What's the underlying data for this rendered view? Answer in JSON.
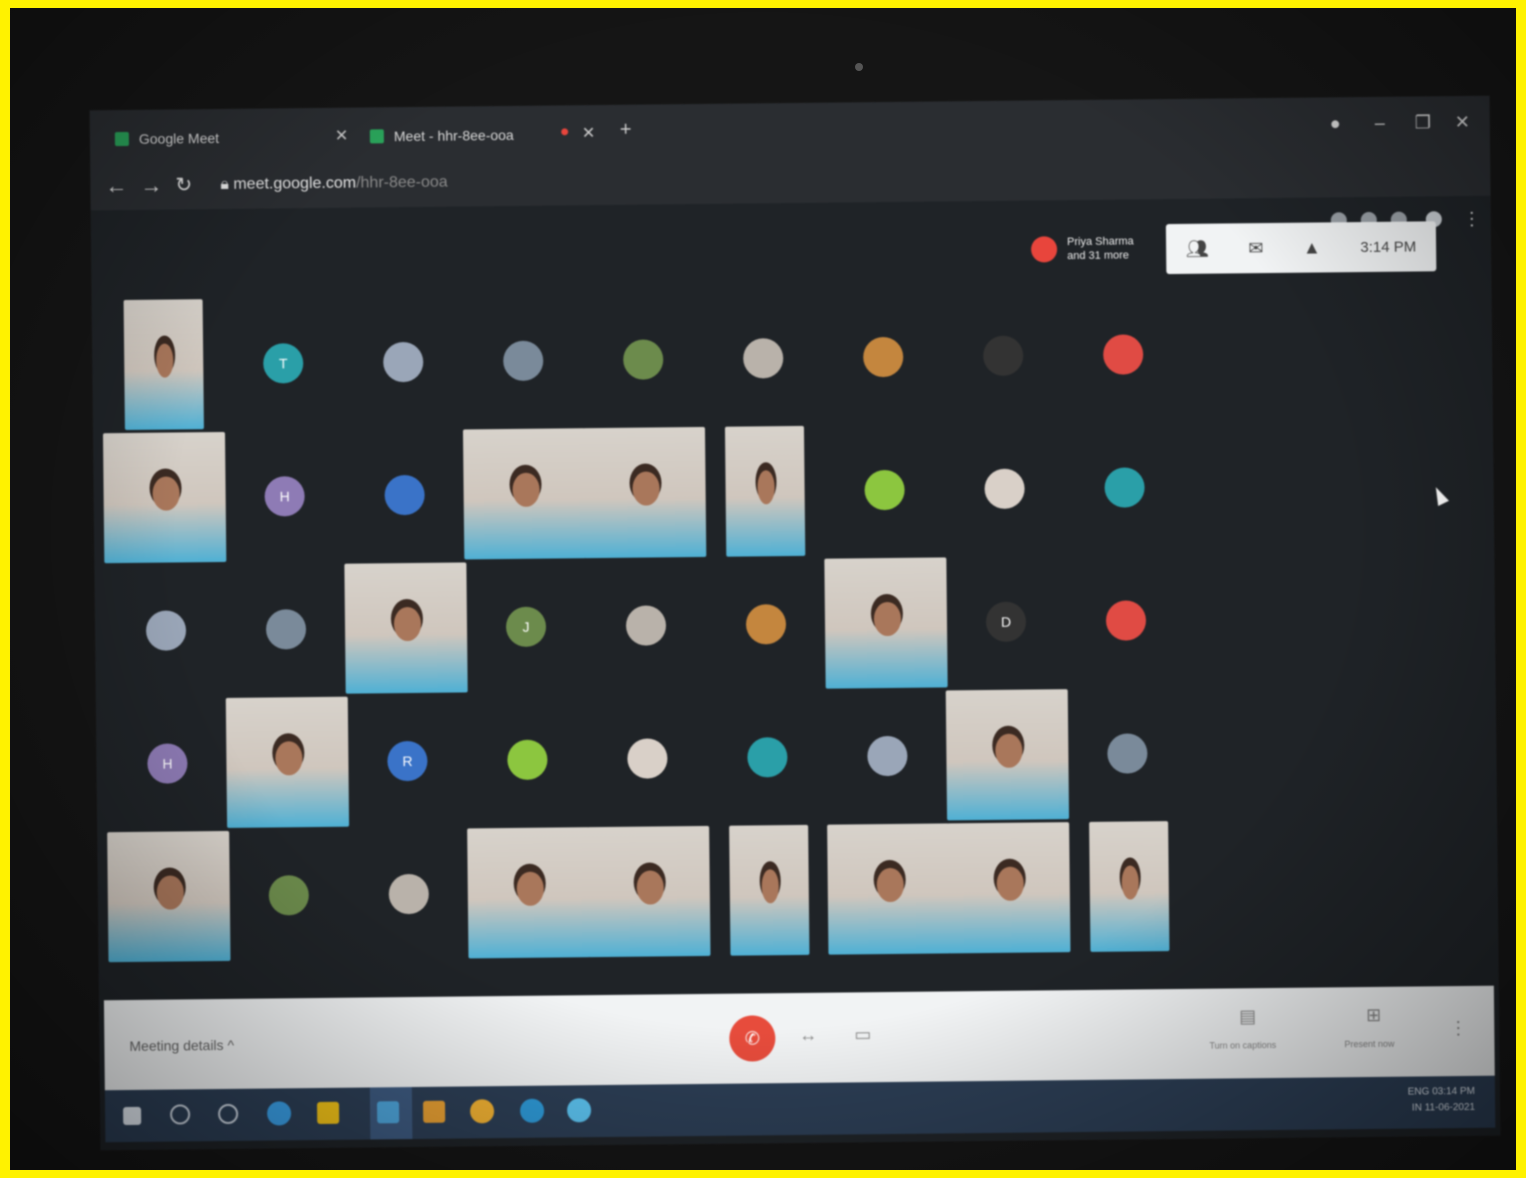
{
  "browser": {
    "tabs": [
      {
        "title": "Google Meet"
      },
      {
        "title": "Meet - hhr-8ee-ooa"
      }
    ],
    "url_host": "meet.google.com",
    "url_path": "/hhr-8ee-ooa"
  },
  "meet": {
    "presenter_name": "Priya Sharma",
    "presenter_more": "and 31 more",
    "clock": "3:14 PM",
    "meeting_details_label": "Meeting details",
    "present_label": "Present now",
    "captions_label": "Turn on captions"
  },
  "taskbar": {
    "time": "03:14 PM",
    "date": "11-06-2021",
    "lang": "ENG",
    "lang2": "IN"
  },
  "tile_letters": [
    "T",
    "H",
    "J",
    "R",
    "D"
  ],
  "colors": {
    "frame": "#151515",
    "screen": "#1f2327",
    "meetbar": "#f1f3f4",
    "endcall": "#e74c3c",
    "taskbar": "#2c3e55"
  }
}
